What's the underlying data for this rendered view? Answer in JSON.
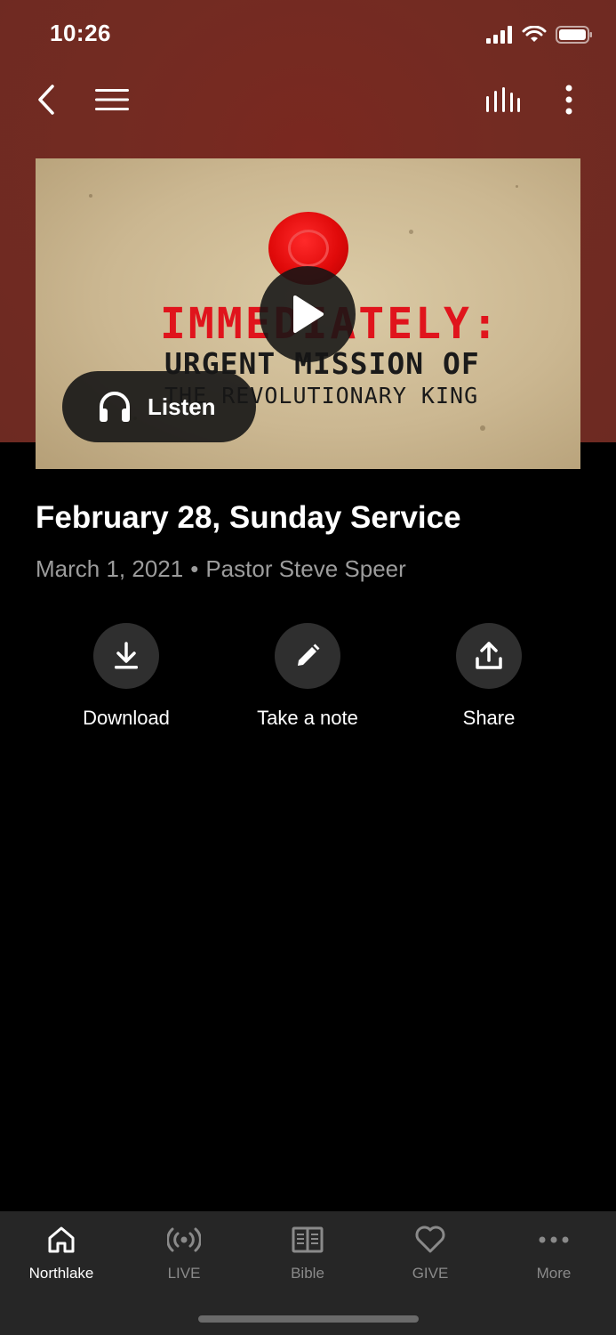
{
  "status_bar": {
    "time": "10:26"
  },
  "nav": {
    "back_icon": "chevron-left-icon",
    "menu_icon": "hamburger-menu-icon",
    "audio_icon": "audio-levels-icon",
    "more_icon": "vertical-dots-icon"
  },
  "media": {
    "thumbnail_text": {
      "line1": "IMMEDIATELY:",
      "line2": "URGENT MISSION OF",
      "line3": "THE REVOLUTIONARY KING"
    },
    "listen_label": "Listen"
  },
  "sermon": {
    "title": "February 28, Sunday Service",
    "date": "March 1, 2021",
    "separator": "•",
    "speaker": "Pastor Steve Speer"
  },
  "actions": [
    {
      "label": "Download",
      "icon": "download-icon"
    },
    {
      "label": "Take a note",
      "icon": "pencil-icon"
    },
    {
      "label": "Share",
      "icon": "share-icon"
    }
  ],
  "tabs": [
    {
      "label": "Northlake",
      "icon": "home-icon",
      "active": true
    },
    {
      "label": "LIVE",
      "icon": "broadcast-icon",
      "active": false
    },
    {
      "label": "Bible",
      "icon": "book-icon",
      "active": false
    },
    {
      "label": "GIVE",
      "icon": "heart-icon",
      "active": false
    },
    {
      "label": "More",
      "icon": "horizontal-dots-icon",
      "active": false
    }
  ],
  "colors": {
    "header_background": "#732b22",
    "background": "#000000",
    "tab_bar": "#262626",
    "active_tab": "#ffffff",
    "inactive_tab": "#8a8a8a",
    "seal_red": "#e00a0a"
  }
}
